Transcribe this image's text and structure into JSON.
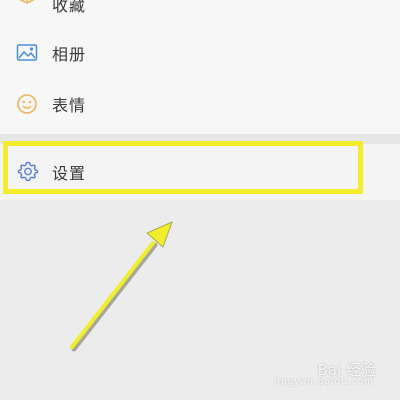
{
  "menu": {
    "items": [
      {
        "label": "收藏",
        "icon": "cube-icon",
        "color": "#f0b45a"
      },
      {
        "label": "相册",
        "icon": "image-icon",
        "color": "#4a90d9"
      },
      {
        "label": "表情",
        "icon": "smiley-icon",
        "color": "#f0b45a"
      }
    ],
    "settings": {
      "label": "设置",
      "icon": "gear-icon",
      "color": "#5b7fd1"
    }
  },
  "annotation": {
    "highlight_color": "#f2ee2b",
    "arrow_color": "#f2ee2b"
  },
  "watermark": {
    "text": "Bai 经验",
    "sub": "jingyan.baidu.com"
  }
}
